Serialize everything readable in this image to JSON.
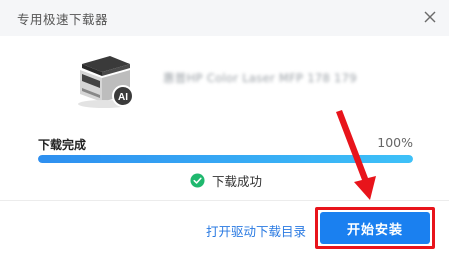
{
  "window": {
    "title": "专用极速下载器",
    "close_icon": "close-icon"
  },
  "device": {
    "icon": "printer-ai-icon",
    "name": "惠普HP Color Laser MFP 178 179"
  },
  "progress": {
    "label": "下载完成",
    "percent_text": "100%",
    "value": 1.0
  },
  "status": {
    "icon": "check-circle-icon",
    "text": "下载成功"
  },
  "footer": {
    "open_dir_link": "打开驱动下载目录",
    "install_button": "开始安装"
  },
  "colors": {
    "accent": "#1a80f0",
    "progress_start": "#2e8ff0",
    "progress_end": "#3ec1f8",
    "success": "#1fb86e",
    "annotation": "#e8141b"
  }
}
